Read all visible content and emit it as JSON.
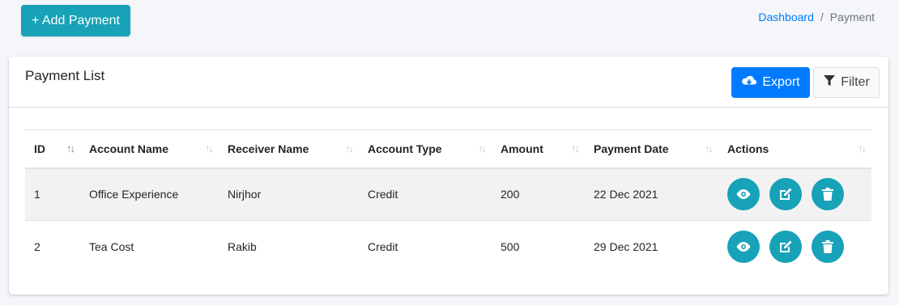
{
  "header": {
    "add_button_label": "+ Add Payment",
    "breadcrumb": {
      "home": "Dashboard",
      "separator": "/",
      "current": "Payment"
    }
  },
  "card": {
    "title": "Payment List",
    "export_label": "Export",
    "filter_label": "Filter"
  },
  "table": {
    "columns": [
      "ID",
      "Account Name",
      "Receiver Name",
      "Account Type",
      "Amount",
      "Payment Date",
      "Actions"
    ],
    "rows": [
      {
        "id": "1",
        "account_name": "Office Experience",
        "receiver_name": "Nirjhor",
        "account_type": "Credit",
        "amount": "200",
        "payment_date": "22 Dec 2021"
      },
      {
        "id": "2",
        "account_name": "Tea Cost",
        "receiver_name": "Rakib",
        "account_type": "Credit",
        "amount": "500",
        "payment_date": "29 Dec 2021"
      }
    ]
  },
  "icons": {
    "view": "eye-icon",
    "edit": "edit-icon",
    "delete": "trash-icon",
    "export": "cloud-download-icon",
    "filter": "filter-icon",
    "sort": "sort-icon"
  },
  "colors": {
    "accent": "#17a2b8",
    "primary": "#007bff",
    "background": "#f4f6f9"
  }
}
